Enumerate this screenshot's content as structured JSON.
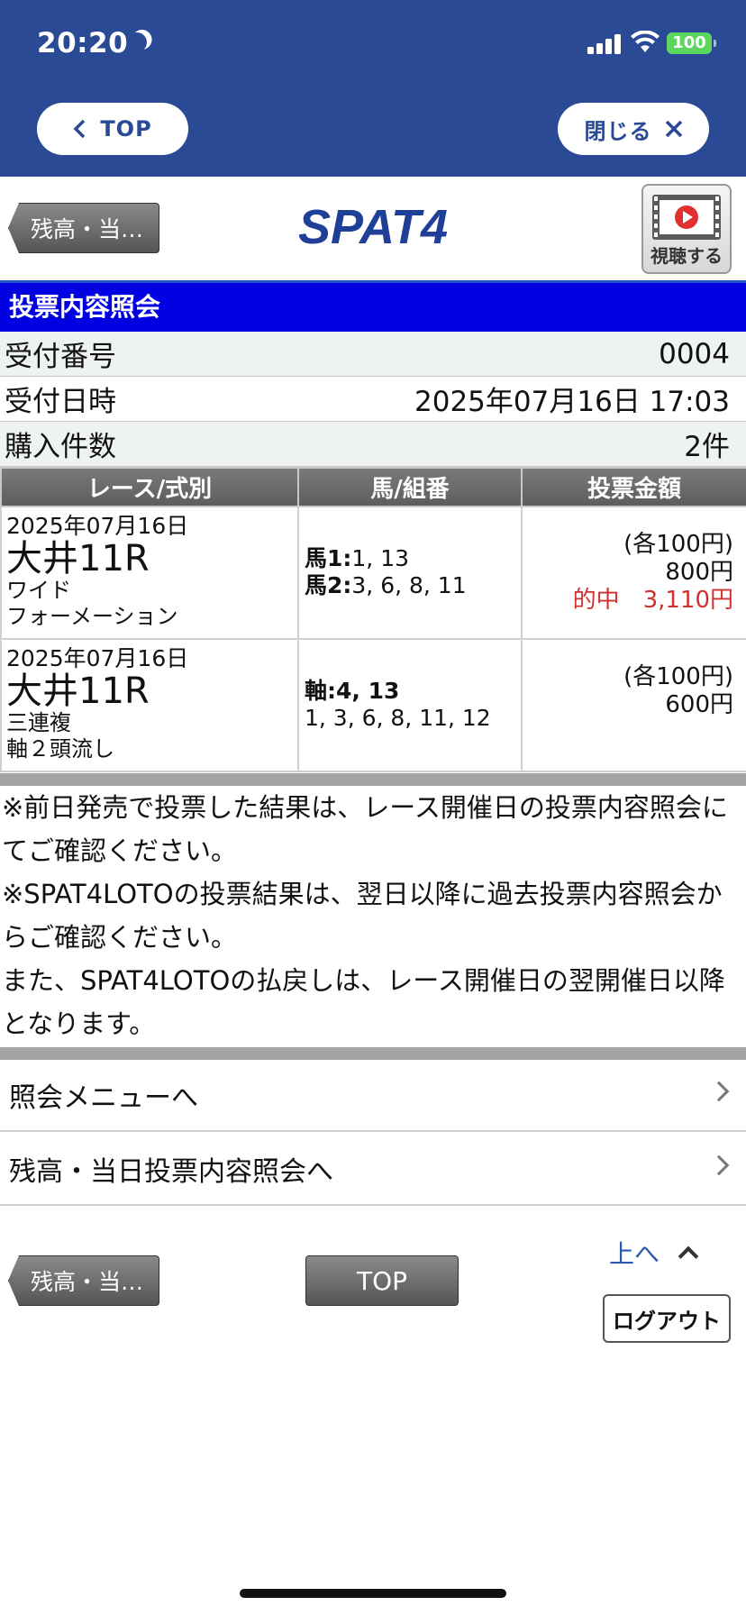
{
  "status_bar": {
    "time": "20:20",
    "battery": "100"
  },
  "browser": {
    "back_label": "TOP",
    "close_label": "閉じる"
  },
  "site": {
    "back_button": "残高・当…",
    "logo_text": "SPAT4",
    "watch_label": "視聴する"
  },
  "page_title": "投票内容照会",
  "receipt": [
    {
      "label": "受付番号",
      "value": "0004"
    },
    {
      "label": "受付日時",
      "value": "2025年07月16日 17:03"
    },
    {
      "label": "購入件数",
      "value": "2件"
    }
  ],
  "table": {
    "headers": [
      "レース/式別",
      "馬/組番",
      "投票金額"
    ],
    "rows": [
      {
        "date": "2025年07月16日",
        "race": "大井11R",
        "bet_type": "ワイド",
        "method": "フォーメーション",
        "combo_line1_label": "馬1:",
        "combo_line1_value": "1, 13",
        "combo_line2_label": "馬2:",
        "combo_line2_value": "3, 6, 8, 11",
        "unit": "(各100円)",
        "total": "800円",
        "hit": "的中　3,110円"
      },
      {
        "date": "2025年07月16日",
        "race": "大井11R",
        "bet_type": "三連複",
        "method": "軸２頭流し",
        "combo_line1_label": "軸:4, 13",
        "combo_line2_value": "1, 3, 6, 8, 11, 12",
        "unit": "(各100円)",
        "total": "600円"
      }
    ]
  },
  "notes": [
    "※前日発売で投票した結果は、レース開催日の投票内容照会にてご確認ください。",
    "※SPAT4LOTOの投票結果は、翌日以降に過去投票内容照会からご確認ください。",
    "また、SPAT4LOTOの払戻しは、レース開催日の翌開催日以降となります。"
  ],
  "menu": [
    {
      "label": "照会メニューへ"
    },
    {
      "label": "残高・当日投票内容照会へ"
    }
  ],
  "footer": {
    "back_button": "残高・当…",
    "top_button": "TOP",
    "up_link": "上へ",
    "logout": "ログアウト"
  }
}
